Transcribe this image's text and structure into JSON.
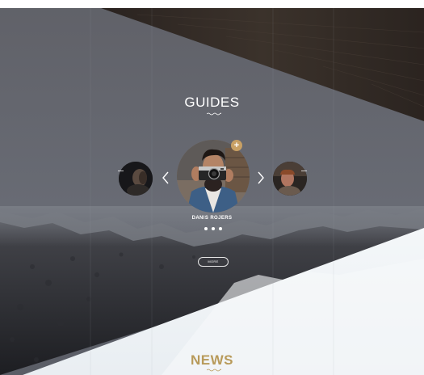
{
  "guides": {
    "title": "GUIDES"
  },
  "carousel": {
    "current_name": "DANIS ROJERS",
    "prev_icon": "chevron-left-icon",
    "next_icon": "chevron-right-icon",
    "badge_icon": "plus-icon",
    "badge_symbol": "+",
    "pagination": {
      "total": 3,
      "active": 1
    },
    "more_label": "MORE"
  },
  "news": {
    "title": "NEWS"
  },
  "colors": {
    "accent_gold": "#c8a064",
    "news_gold": "#b89a5a",
    "overlay_gray": "#5e6169",
    "snow_white": "#eef2f5"
  }
}
